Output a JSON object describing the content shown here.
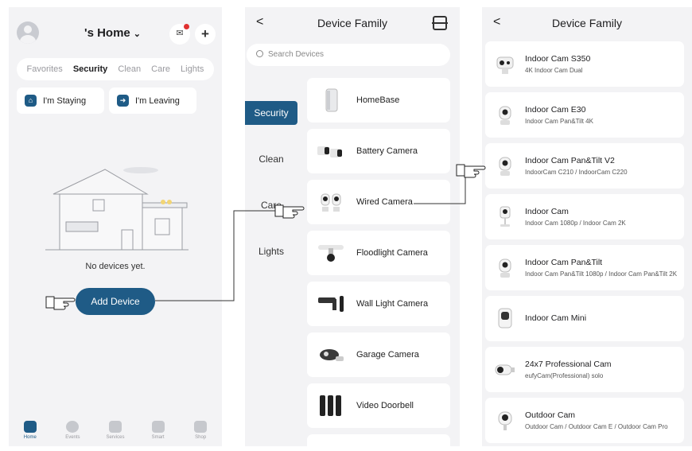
{
  "panel1": {
    "home_title": "'s Home",
    "tabs": [
      "Favorites",
      "Security",
      "Clean",
      "Care",
      "Lights"
    ],
    "active_tab": "Security",
    "mode_stay": "I'm Staying",
    "mode_leave": "I'm Leaving",
    "empty_text": "No devices yet.",
    "add_device": "Add Device",
    "nav": [
      "Home",
      "Events",
      "Services",
      "Smart",
      "Shop"
    ]
  },
  "panel2": {
    "title": "Device Family",
    "search_placeholder": "Search Devices",
    "categories": [
      "Security",
      "Clean",
      "Care",
      "Lights"
    ],
    "devices": [
      "HomeBase",
      "Battery Camera",
      "Wired Camera",
      "Floodlight Camera",
      "Wall Light Camera",
      "Garage Camera",
      "Video Doorbell"
    ]
  },
  "panel3": {
    "title": "Device Family",
    "devices": [
      {
        "name": "Indoor Cam S350",
        "sub": "4K Indoor Cam Dual"
      },
      {
        "name": "Indoor Cam E30",
        "sub": "Indoor Cam Pan&Tilt 4K"
      },
      {
        "name": "Indoor Cam Pan&Tilt V2",
        "sub": "IndoorCam C210 / IndoorCam C220"
      },
      {
        "name": "Indoor Cam",
        "sub": "Indoor Cam 1080p / Indoor Cam 2K"
      },
      {
        "name": "Indoor Cam Pan&Tilt",
        "sub": "Indoor Cam Pan&Tilt 1080p / Indoor Cam Pan&Tilt 2K"
      },
      {
        "name": "Indoor Cam Mini",
        "sub": ""
      },
      {
        "name": "24x7 Professional Cam",
        "sub": "eufyCam(Professional) solo"
      },
      {
        "name": "Outdoor Cam",
        "sub": "Outdoor Cam / Outdoor Cam E / Outdoor Cam Pro"
      }
    ]
  },
  "colors": {
    "accent": "#1f5b86",
    "badge": "#e03131",
    "background": "#f3f3f5"
  }
}
